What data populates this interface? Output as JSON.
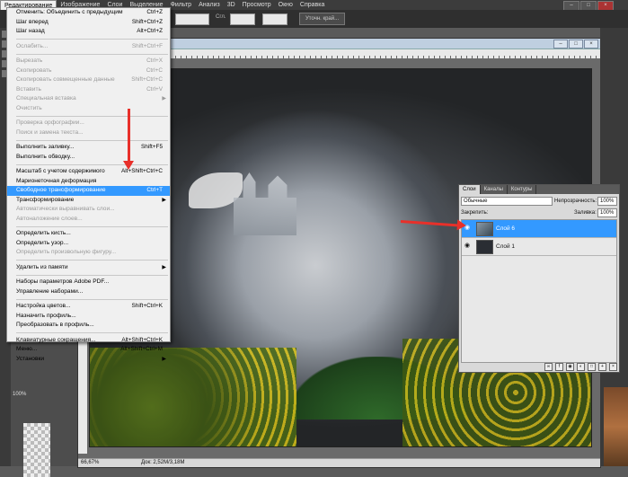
{
  "menubar": {
    "items": [
      "Редактирование",
      "Изображение",
      "Слои",
      "Выделение",
      "Фильтр",
      "Анализ",
      "3D",
      "Просмотр",
      "Окно",
      "Справка"
    ],
    "active_index": 0
  },
  "options": {
    "edge_label": "Сгл.",
    "refine_button": "Уточн. край..."
  },
  "edit_menu": {
    "groups": [
      [
        {
          "label": "Отменить: Объединить с предыдущим",
          "shortcut": "Ctrl+Z",
          "disabled": false
        },
        {
          "label": "Шаг вперед",
          "shortcut": "Shift+Ctrl+Z",
          "disabled": false
        },
        {
          "label": "Шаг назад",
          "shortcut": "Alt+Ctrl+Z",
          "disabled": false
        }
      ],
      [
        {
          "label": "Ослабить...",
          "shortcut": "Shift+Ctrl+F",
          "disabled": true
        }
      ],
      [
        {
          "label": "Вырезать",
          "shortcut": "Ctrl+X",
          "disabled": true
        },
        {
          "label": "Скопировать",
          "shortcut": "Ctrl+C",
          "disabled": true
        },
        {
          "label": "Скопировать совмещенные данные",
          "shortcut": "Shift+Ctrl+C",
          "disabled": true
        },
        {
          "label": "Вставить",
          "shortcut": "Ctrl+V",
          "disabled": true
        },
        {
          "label": "Специальная вставка",
          "shortcut": "",
          "disabled": true,
          "submenu": true
        },
        {
          "label": "Очистить",
          "shortcut": "",
          "disabled": true
        }
      ],
      [
        {
          "label": "Проверка орфографии...",
          "shortcut": "",
          "disabled": true
        },
        {
          "label": "Поиск и замена текста...",
          "shortcut": "",
          "disabled": true
        }
      ],
      [
        {
          "label": "Выполнить заливку...",
          "shortcut": "Shift+F5",
          "disabled": false
        },
        {
          "label": "Выполнить обводку...",
          "shortcut": "",
          "disabled": false
        }
      ],
      [
        {
          "label": "Масштаб с учетом содержимого",
          "shortcut": "Alt+Shift+Ctrl+C",
          "disabled": false
        },
        {
          "label": "Марионеточная деформация",
          "shortcut": "",
          "disabled": false
        },
        {
          "label": "Свободное трансформирование",
          "shortcut": "Ctrl+T",
          "disabled": false,
          "selected": true
        },
        {
          "label": "Трансформирование",
          "shortcut": "",
          "disabled": false,
          "submenu": true
        },
        {
          "label": "Автоматически выравнивать слои...",
          "shortcut": "",
          "disabled": true
        },
        {
          "label": "Автоналожение слоев...",
          "shortcut": "",
          "disabled": true
        }
      ],
      [
        {
          "label": "Определить кисть...",
          "shortcut": "",
          "disabled": false
        },
        {
          "label": "Определить узор...",
          "shortcut": "",
          "disabled": false
        },
        {
          "label": "Определить произвольную фигуру...",
          "shortcut": "",
          "disabled": true
        }
      ],
      [
        {
          "label": "Удалить из памяти",
          "shortcut": "",
          "disabled": false,
          "submenu": true
        }
      ],
      [
        {
          "label": "Наборы параметров Adobe PDF...",
          "shortcut": "",
          "disabled": false
        },
        {
          "label": "Управление наборами...",
          "shortcut": "",
          "disabled": false
        }
      ],
      [
        {
          "label": "Настройка цветов...",
          "shortcut": "Shift+Ctrl+K",
          "disabled": false
        },
        {
          "label": "Назначить профиль...",
          "shortcut": "",
          "disabled": false
        },
        {
          "label": "Преобразовать в профиль...",
          "shortcut": "",
          "disabled": false
        }
      ],
      [
        {
          "label": "Клавиатурные сокращения...",
          "shortcut": "Alt+Shift+Ctrl+K",
          "disabled": false
        },
        {
          "label": "Меню...",
          "shortcut": "Alt+Shift+Ctrl+M",
          "disabled": false
        },
        {
          "label": "Установки",
          "shortcut": "",
          "disabled": false,
          "submenu": true
        }
      ]
    ]
  },
  "layers_panel": {
    "tabs": [
      "Слои",
      "Каналы",
      "Контуры"
    ],
    "blend_mode": "Обычные",
    "opacity_label": "Непрозрачность:",
    "opacity_value": "100%",
    "lock_label": "Закрепить:",
    "fill_label": "Заливка:",
    "fill_value": "100%",
    "layers": [
      {
        "name": "Слой 6",
        "selected": true
      },
      {
        "name": "Слой 1",
        "selected": false
      }
    ]
  },
  "status": {
    "zoom": "66,67%",
    "doc": "Док: 2,52M/3,18M"
  },
  "left_panel": {
    "percent": "100%"
  },
  "colors": {
    "accent": "#3399ff",
    "arrow": "#e8302a"
  }
}
